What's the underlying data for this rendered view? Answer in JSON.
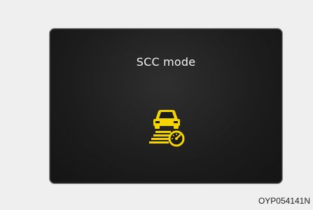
{
  "display": {
    "title": "SCC mode",
    "icon": "scc-mode-icon",
    "icon_color": "#f5d400",
    "background_color": "#1c1c1c"
  },
  "image_code": "OYP054141N"
}
